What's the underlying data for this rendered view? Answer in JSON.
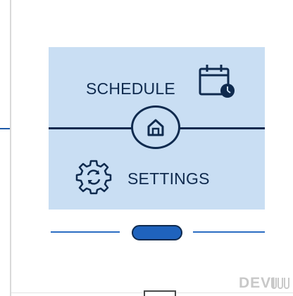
{
  "screen": {
    "schedule_label": "SCHEDULE",
    "settings_label": "SETTINGS",
    "icons": {
      "schedule": "calendar-clock-icon",
      "settings": "gear-sync-icon",
      "home": "home-icon"
    }
  },
  "device": {
    "brand": "DEVI",
    "brand_mark": "devi-logo-mark"
  },
  "colors": {
    "screen_bg": "#c9def3",
    "ink": "#0f2a4e",
    "accent": "#1f63bd",
    "brand": "#c8c8c8"
  }
}
